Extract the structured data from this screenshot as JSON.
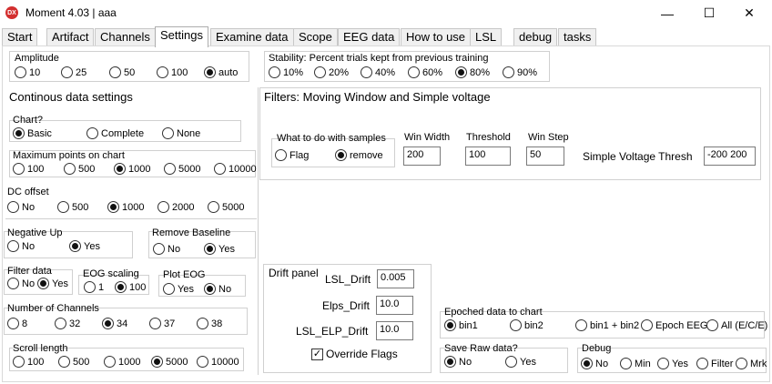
{
  "window": {
    "app_icon_text": "DX",
    "title": "Moment 4.03 | aaa",
    "minimize": "—",
    "maximize": "☐",
    "close": "✕"
  },
  "tabs": [
    "Start",
    "Artifact",
    "Channels",
    "Settings",
    "Examine data",
    "Scope",
    "EEG data",
    "How to use",
    "LSL",
    "debug",
    "tasks"
  ],
  "active_tab": "Settings",
  "amplitude": {
    "title": "Amplitude",
    "options": [
      "10",
      "25",
      "50",
      "100",
      "auto"
    ],
    "selected": "auto"
  },
  "stability": {
    "title": "Stability: Percent trials kept from previous training",
    "options": [
      "10%",
      "20%",
      "40%",
      "60%",
      "80%",
      "90%"
    ],
    "selected": "80%"
  },
  "continuous": {
    "title": "Continous data settings",
    "chart": {
      "title": "Chart?",
      "options": [
        "Basic",
        "Complete",
        "None"
      ],
      "selected": "Basic"
    },
    "max_points": {
      "title": "Maximum points on chart",
      "options": [
        "100",
        "500",
        "1000",
        "5000",
        "10000"
      ],
      "selected": "1000"
    },
    "dc_offset": {
      "title": "DC offset",
      "options": [
        "No",
        "500",
        "1000",
        "2000",
        "5000"
      ],
      "selected": "1000"
    },
    "negative_up": {
      "title": "Negative Up",
      "options": [
        "No",
        "Yes"
      ],
      "selected": "Yes"
    },
    "remove_baseline": {
      "title": "Remove Baseline",
      "options": [
        "No",
        "Yes"
      ],
      "selected": "Yes"
    },
    "filter_data": {
      "title": "Filter data",
      "options": [
        "No",
        "Yes"
      ],
      "selected": "Yes"
    },
    "eog_scaling": {
      "title": "EOG scaling",
      "options": [
        "1",
        "100"
      ],
      "selected": "100"
    },
    "plot_eog": {
      "title": "Plot EOG",
      "options": [
        "Yes",
        "No"
      ],
      "selected": "No"
    },
    "num_channels": {
      "title": "Number of Channels",
      "options": [
        "8",
        "32",
        "34",
        "37",
        "38"
      ],
      "selected": "34"
    },
    "scroll_length": {
      "title": "Scroll length",
      "options": [
        "100",
        "500",
        "1000",
        "5000",
        "10000"
      ],
      "selected": "5000"
    }
  },
  "filters": {
    "title": "Filters: Moving Window and Simple voltage",
    "samples": {
      "title": "What to do with samples",
      "options": [
        "Flag",
        "remove"
      ],
      "selected": "remove"
    },
    "win_width_label": "Win Width",
    "win_width": "200",
    "threshold_label": "Threshold",
    "threshold": "100",
    "win_step_label": "Win Step",
    "win_step": "50",
    "simple_voltage_label": "Simple Voltage Thresh",
    "simple_voltage": "-200 200"
  },
  "drift": {
    "title": "Drift panel",
    "lsl_drift_label": "LSL_Drift",
    "lsl_drift": "0.005",
    "elps_drift_label": "Elps_Drift",
    "elps_drift": "10.0",
    "lsl_elp_drift_label": "LSL_ELP_Drift",
    "lsl_elp_drift": "10.0",
    "override_label": "Override Flags",
    "override_checked": true
  },
  "epoched": {
    "title": "Epoched data to chart",
    "options": [
      "bin1",
      "bin2",
      "bin1 + bin2",
      "Epoch EEG",
      "All (E/C/E)"
    ],
    "selected": "bin1"
  },
  "save_raw": {
    "title": "Save Raw data?",
    "options": [
      "No",
      "Yes"
    ],
    "selected": "No"
  },
  "debug": {
    "title": "Debug",
    "options": [
      "No",
      "Min",
      "Yes",
      "Filter",
      "Mrk"
    ],
    "selected": "No"
  },
  "colors": {
    "accent_red": "#d32f2f",
    "border": "#d0d0d0",
    "tab_bg": "#f0f0f0"
  }
}
